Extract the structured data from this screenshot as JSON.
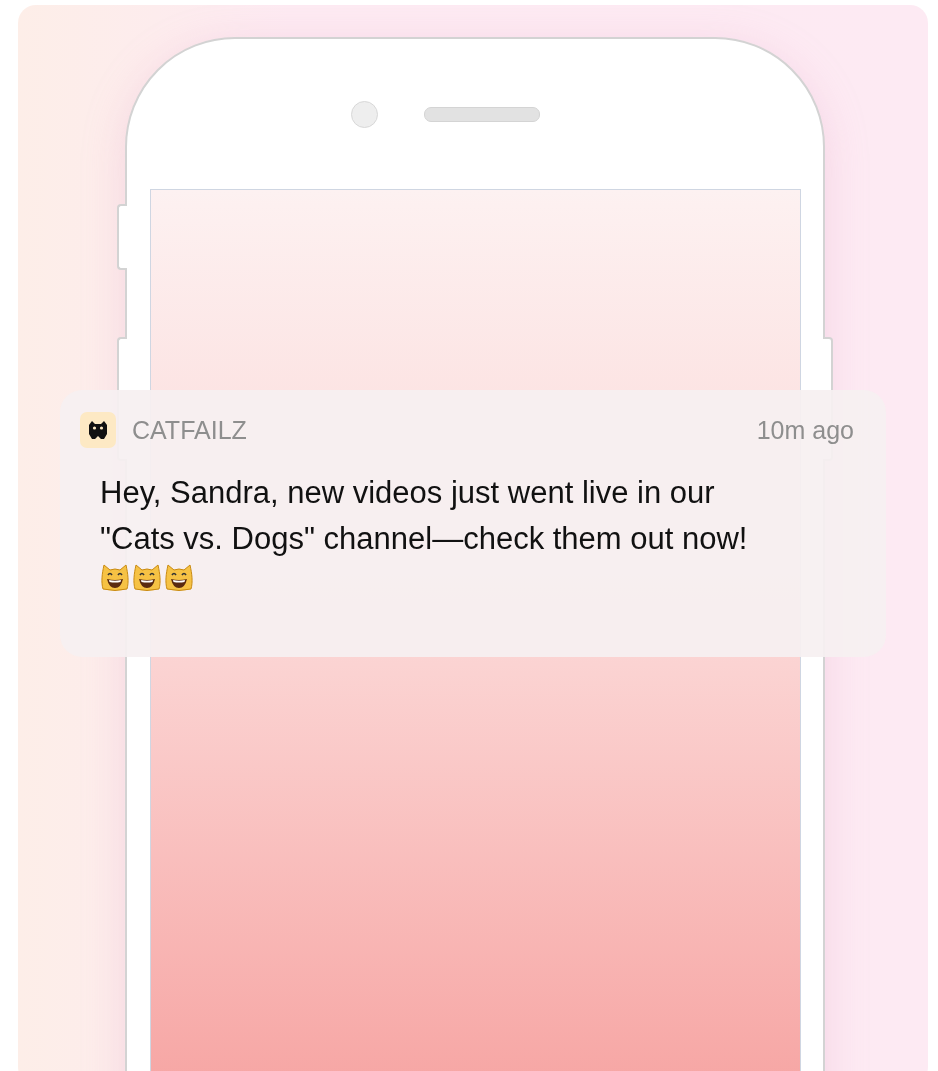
{
  "notification": {
    "app_name": "CATFAILZ",
    "time": "10m ago",
    "message": "Hey, Sandra, new videos just went live in our \"Cats vs. Dogs\" channel—check them out now!",
    "emojis": [
      {
        "kind": "grinning_cat"
      },
      {
        "kind": "grinning_cat"
      },
      {
        "kind": "grinning_cat"
      }
    ]
  }
}
